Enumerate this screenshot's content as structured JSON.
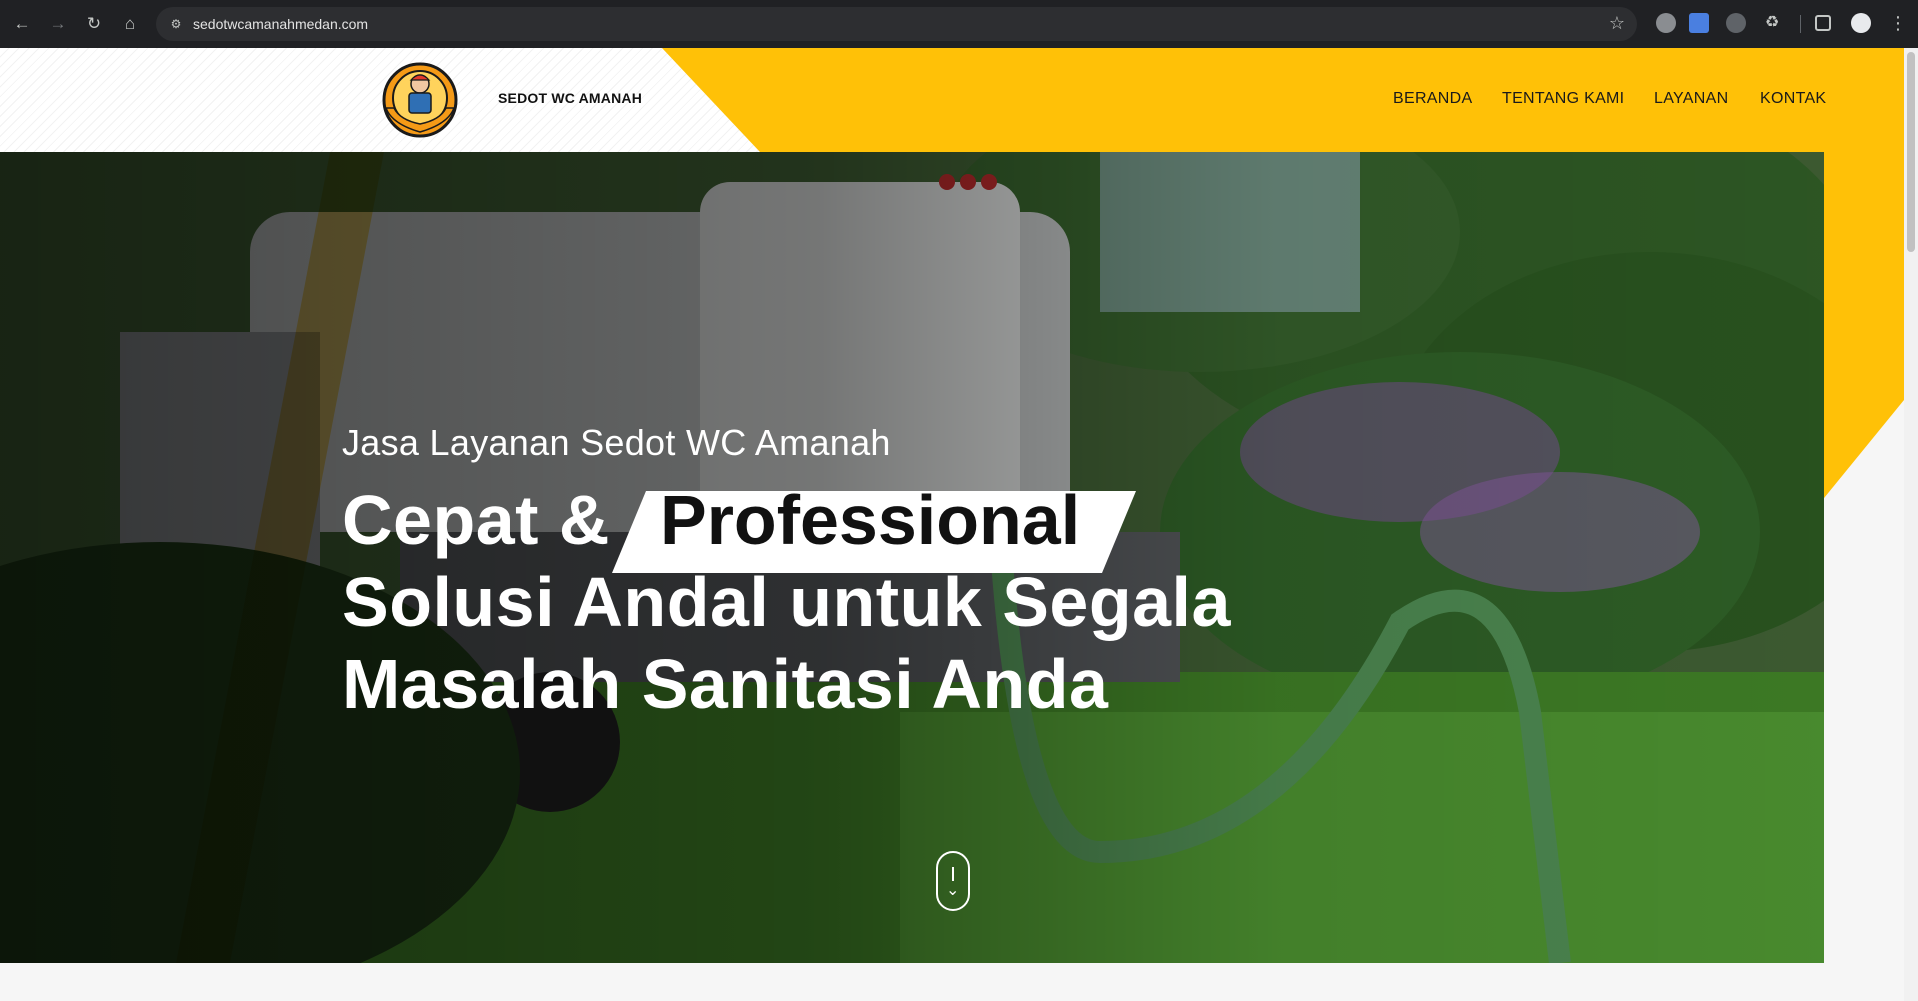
{
  "browser": {
    "url": "sedotwcamanahmedan.com",
    "back_icon": "back-arrow-icon",
    "forward_icon": "forward-arrow-icon",
    "reload_icon": "reload-icon",
    "home_icon": "home-icon"
  },
  "site": {
    "logo_alt": "SEDOT WC AMANAH",
    "brand": "SEDOT WC AMANAH",
    "nav": [
      "BERANDA",
      "TENTANG KAMI",
      "LAYANAN",
      "KONTAK"
    ]
  },
  "hero": {
    "subtitle": "Jasa Layanan Sedot WC Amanah",
    "title_prefix": "Cepat &",
    "title_highlight": "Professional",
    "title_line2": "Solusi Andal untuk Segala",
    "title_line3": "Masalah Sanitasi Anda"
  },
  "colors": {
    "accent": "#ffc107",
    "chrome_bg": "#202124",
    "text_dark": "#111111"
  }
}
